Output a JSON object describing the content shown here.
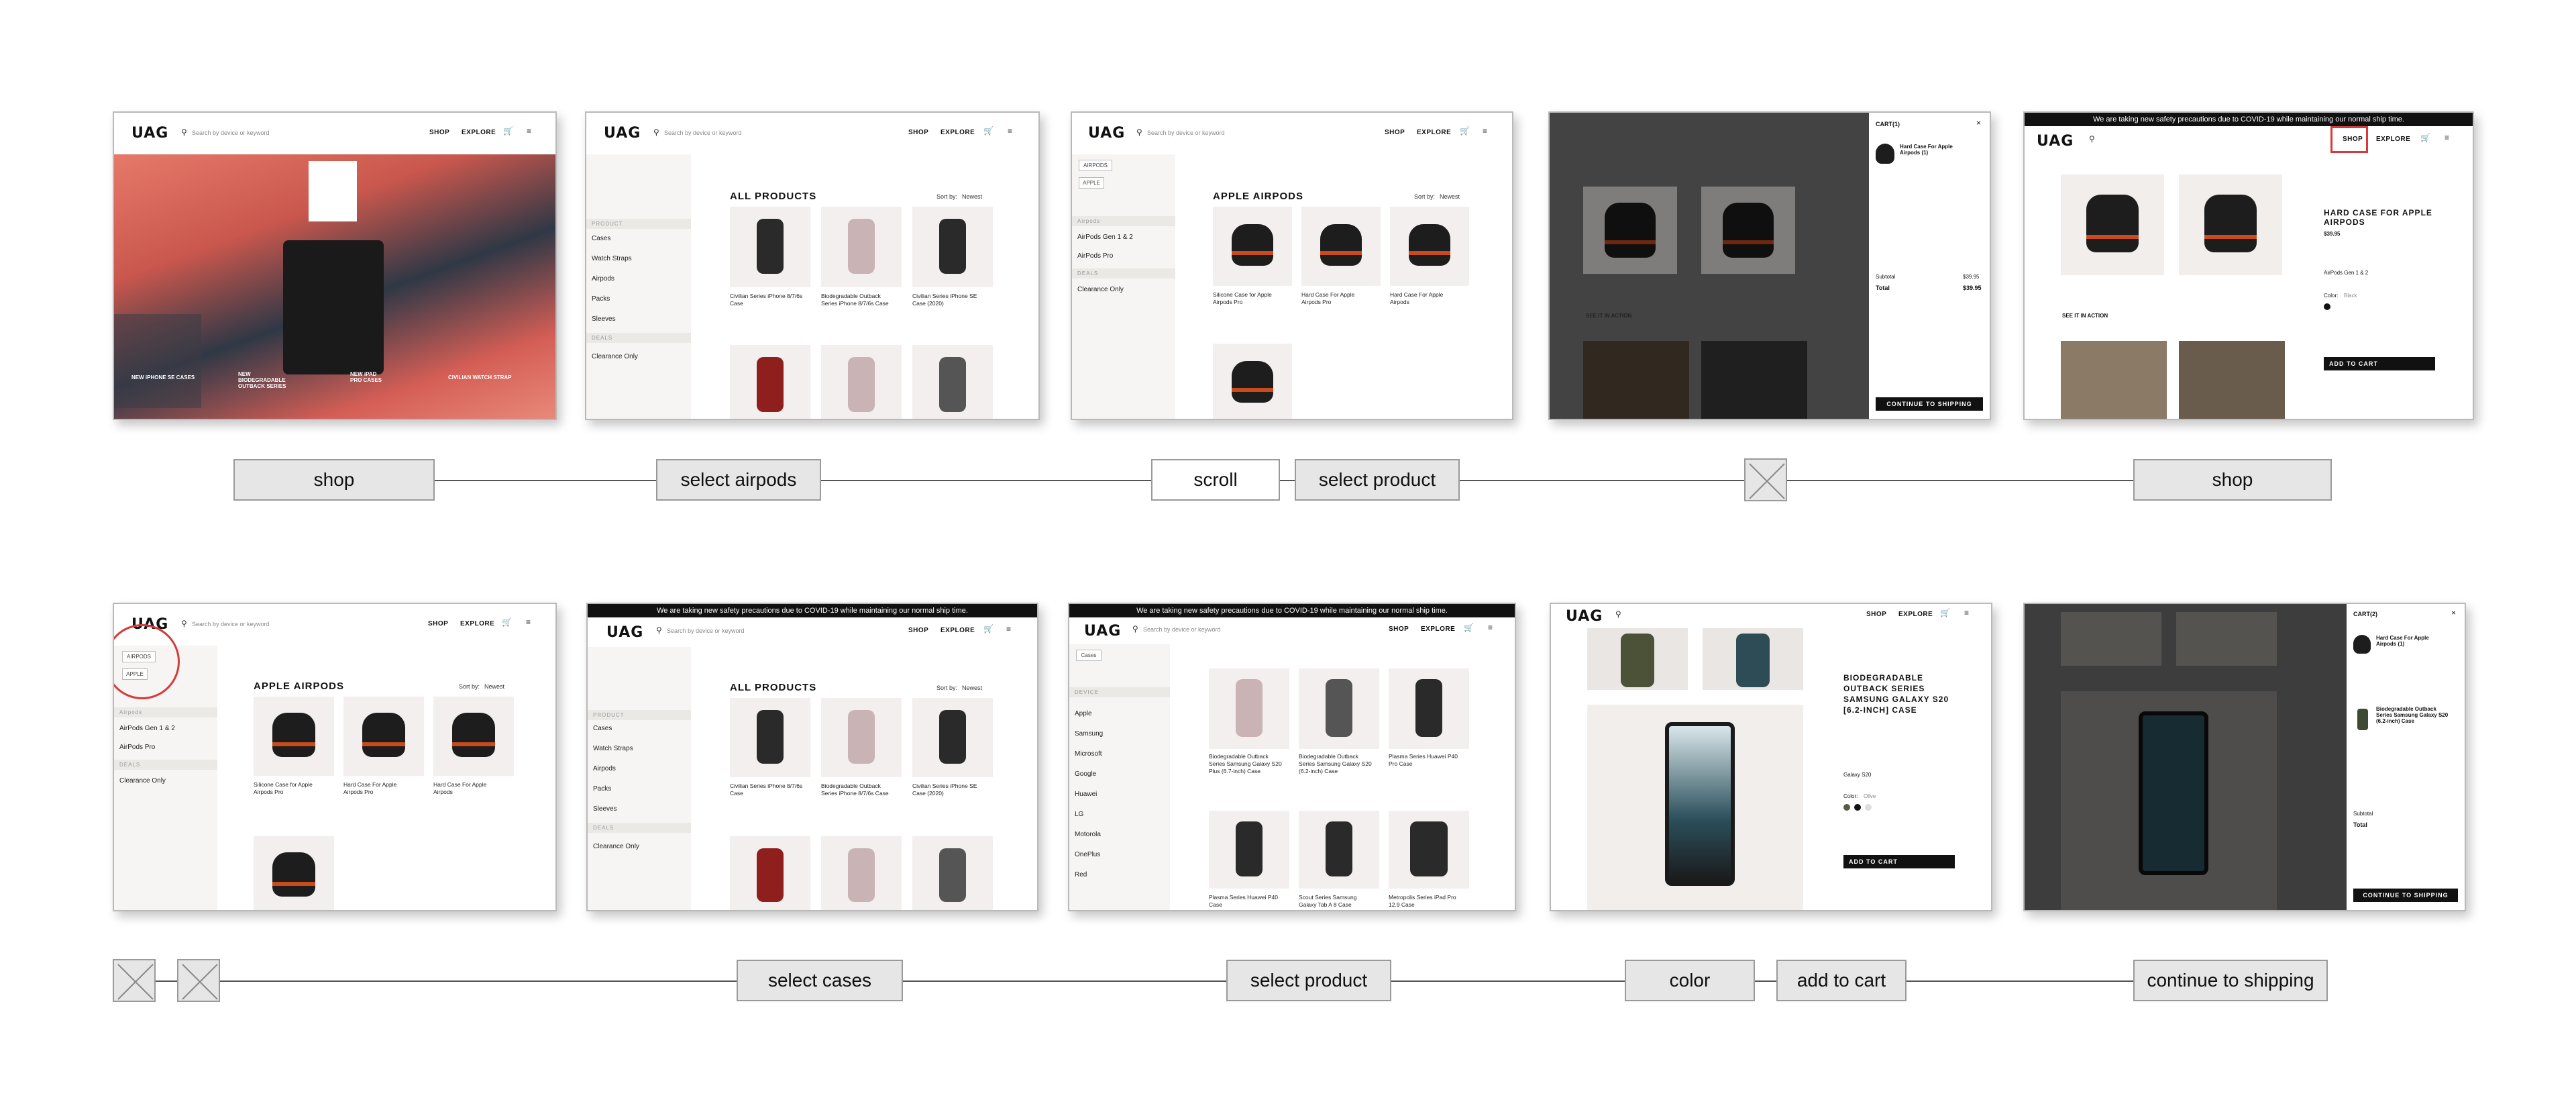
{
  "row1_steps": [
    {
      "label": "shop"
    },
    {
      "label": "select airpods"
    },
    {
      "label": "scroll"
    },
    {
      "label": "select product"
    },
    {
      "label": "shop"
    }
  ],
  "row2_steps": [
    {
      "label": "select cases"
    },
    {
      "label": "select product"
    },
    {
      "label": "color"
    },
    {
      "label": "add to cart"
    },
    {
      "label": "continue to shipping"
    }
  ],
  "ui": {
    "logo": "UAG",
    "search_placeholder": "Search by device or keyword",
    "nav_shop": "SHOP",
    "nav_explore": "EXPLORE",
    "promo": "We are taking new safety precautions due to COVID-19 while maintaining our normal ship time.",
    "all_products": "ALL PRODUCTS",
    "apple_airpods": "APPLE AIRPODS",
    "sort_by": "Sort by:",
    "sort_value": "Newest",
    "sidebar": {
      "product_head": "PRODUCT",
      "cases": "Cases",
      "watch_straps": "Watch Straps",
      "airpods": "Airpods",
      "packs": "Packs",
      "sleeves": "Sleeves",
      "deals_head": "DEALS",
      "clearance": "Clearance Only",
      "airpods_gen": "AirPods Gen 1 & 2",
      "airpods_pro": "AirPods Pro",
      "chip_airpods": "AIRPODS",
      "chip_apple": "APPLE",
      "apple": "Apple",
      "samsung": "Samsung",
      "microsoft": "Microsoft",
      "google": "Google",
      "huawei": "Huawei",
      "lg": "LG",
      "motorola": "Motorola",
      "oneplus": "OnePlus",
      "red": "Red",
      "device_head": "DEVICE"
    },
    "hero": {
      "tag1": "NEW iPHONE SE CASES",
      "tag2": "NEW BIODEGRADABLE OUTBACK SERIES",
      "tag3": "NEW iPAD PRO CASES",
      "tag4": "CIVILIAN WATCH STRAP"
    },
    "products_1": [
      "Civilian Series iPhone 8/7/6s Case",
      "Biodegradable Outback Series iPhone 8/7/6s Case",
      "Civilian Series iPhone SE Case (2020)"
    ],
    "airpods_products": [
      "Silicone Case for Apple Airpods Pro",
      "Hard Case For Apple Airpods Pro",
      "Hard Case For Apple Airpods"
    ],
    "cases_products": [
      "Biodegradable Outback Series Samsung Galaxy S20 Plus (6.7-inch) Case",
      "Biodegradable Outback Series Samsung Galaxy S20 (6.2-inch) Case",
      "Plasma Series Huawei P40 Pro Case",
      "Plasma Series Huawei P40 Case",
      "Scout Series Samsung Galaxy Tab A 8 Case",
      "Metropolis Series iPad Pro 12.9 Case"
    ],
    "cart_title": "CART(1)",
    "cart_title_2": "CART(2)",
    "cart_item_1": "Hard Case For Apple Airpods (1)",
    "cart_item_2": "Biodegradable Outback Series Samsung Galaxy S20 (6.2-inch) Case",
    "subtotal": "Subtotal",
    "total": "Total",
    "price_1": "$39.95",
    "continue_shipping": "CONTINUE TO SHIPPING",
    "pdp_airpods_title": "HARD CASE FOR APPLE AIRPODS",
    "pdp_s20_title": "BIODEGRADABLE OUTBACK SERIES SAMSUNG GALAXY S20 [6.2-INCH] CASE",
    "see_in_action": "SEE IT IN ACTION",
    "add_to_cart": "ADD TO CART",
    "airpods_gen_select": "AirPods Gen 1 & 2",
    "galaxy_s20": "Galaxy S20",
    "color_label": "Color:",
    "color_black": "Black",
    "color_olive": "Olive"
  }
}
